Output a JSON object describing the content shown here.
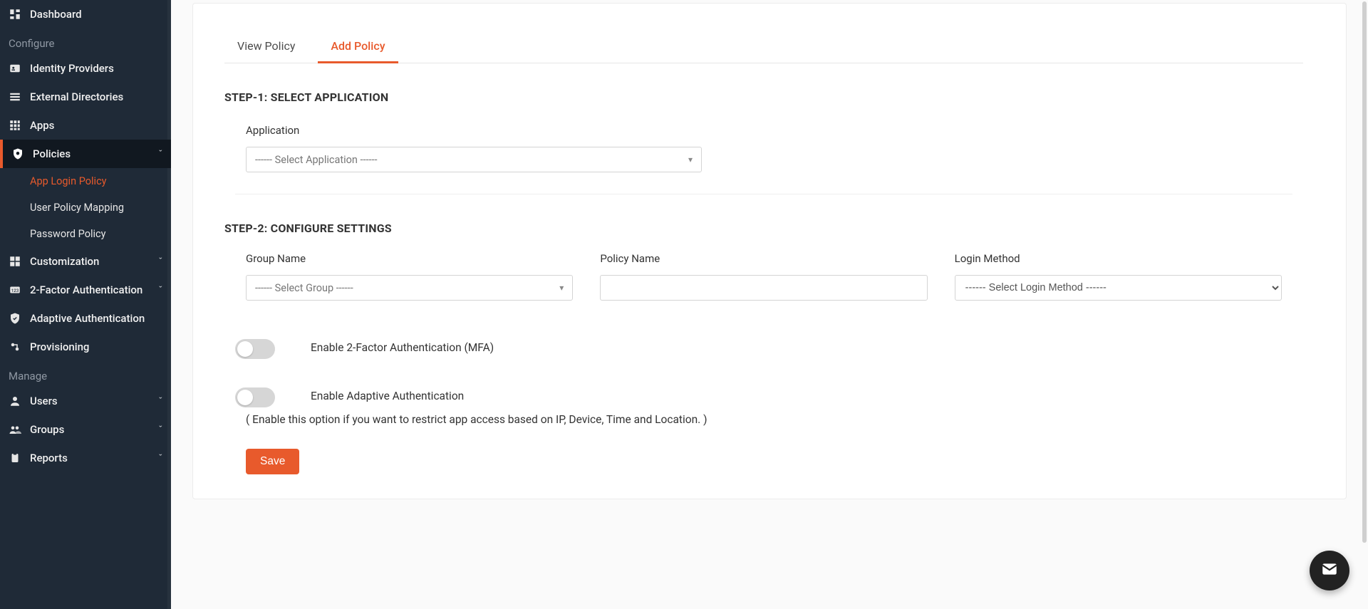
{
  "sidebar": {
    "dashboard": "Dashboard",
    "sections": {
      "configure": "Configure",
      "manage": "Manage"
    },
    "identity_providers": "Identity Providers",
    "external_directories": "External Directories",
    "apps": "Apps",
    "policies": "Policies",
    "policies_children": {
      "app_login_policy": "App Login Policy",
      "user_policy_mapping": "User Policy Mapping",
      "password_policy": "Password Policy"
    },
    "customization": "Customization",
    "two_factor": "2-Factor Authentication",
    "adaptive_auth": "Adaptive Authentication",
    "provisioning": "Provisioning",
    "users": "Users",
    "groups": "Groups",
    "reports": "Reports"
  },
  "tabs": {
    "view": "View Policy",
    "add": "Add Policy"
  },
  "step1": {
    "title": "STEP-1: SELECT APPLICATION",
    "application_label": "Application",
    "application_placeholder": "------ Select Application ------"
  },
  "step2": {
    "title": "STEP-2: CONFIGURE SETTINGS",
    "group_label": "Group Name",
    "group_placeholder": "------ Select Group ------",
    "policy_label": "Policy Name",
    "policy_value": "",
    "login_method_label": "Login Method",
    "login_method_placeholder": "------ Select Login Method ------",
    "enable_mfa_label": "Enable 2-Factor Authentication (MFA)",
    "enable_adaptive_label": "Enable Adaptive Authentication",
    "enable_adaptive_help": "( Enable this option if you want to restrict app access based on IP, Device, Time and Location. )",
    "save_label": "Save"
  }
}
